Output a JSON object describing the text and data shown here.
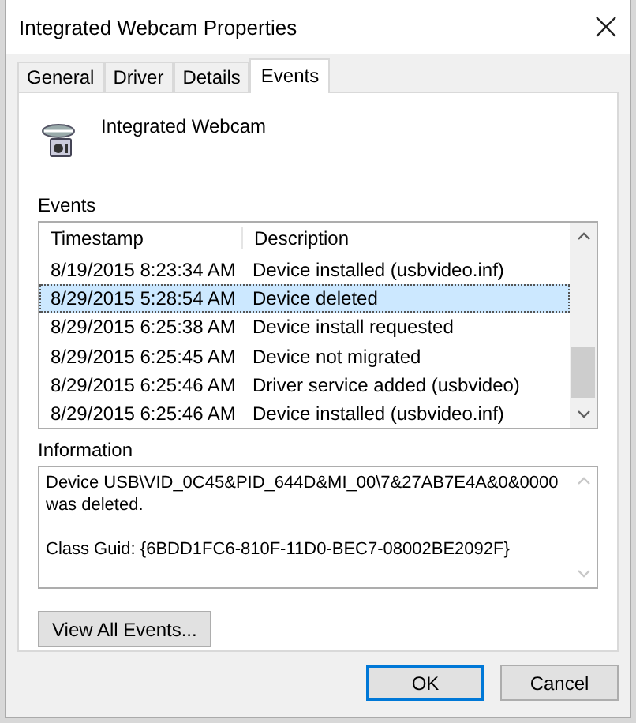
{
  "window": {
    "title": "Integrated Webcam Properties"
  },
  "tabs": [
    {
      "label": "General",
      "selected": false
    },
    {
      "label": "Driver",
      "selected": false
    },
    {
      "label": "Details",
      "selected": false
    },
    {
      "label": "Events",
      "selected": true
    }
  ],
  "device": {
    "name": "Integrated Webcam"
  },
  "events": {
    "label": "Events",
    "columns": [
      "Timestamp",
      "Description"
    ],
    "rows": [
      {
        "timestamp": "8/19/2015 8:23:34 AM",
        "description": "Device installed (usbvideo.inf)",
        "selected": false
      },
      {
        "timestamp": "8/29/2015 5:28:54 AM",
        "description": "Device deleted",
        "selected": true
      },
      {
        "timestamp": "8/29/2015 6:25:38 AM",
        "description": "Device install requested",
        "selected": false
      },
      {
        "timestamp": "8/29/2015 6:25:45 AM",
        "description": "Device not migrated",
        "selected": false
      },
      {
        "timestamp": "8/29/2015 6:25:46 AM",
        "description": "Driver service added (usbvideo)",
        "selected": false
      },
      {
        "timestamp": "8/29/2015 6:25:46 AM",
        "description": "Device installed (usbvideo.inf)",
        "selected": false
      }
    ]
  },
  "information": {
    "label": "Information",
    "paragraphs": [
      "Device USB\\VID_0C45&PID_644D&MI_00\\7&27AB7E4A&0&0000 was deleted.",
      "Class Guid: {6BDD1FC6-810F-11D0-BEC7-08002BE2092F}"
    ]
  },
  "view_all_button": "View All Events...",
  "buttons": [
    {
      "label": "OK",
      "kind": "default"
    },
    {
      "label": "Cancel",
      "kind": "normal"
    }
  ]
}
